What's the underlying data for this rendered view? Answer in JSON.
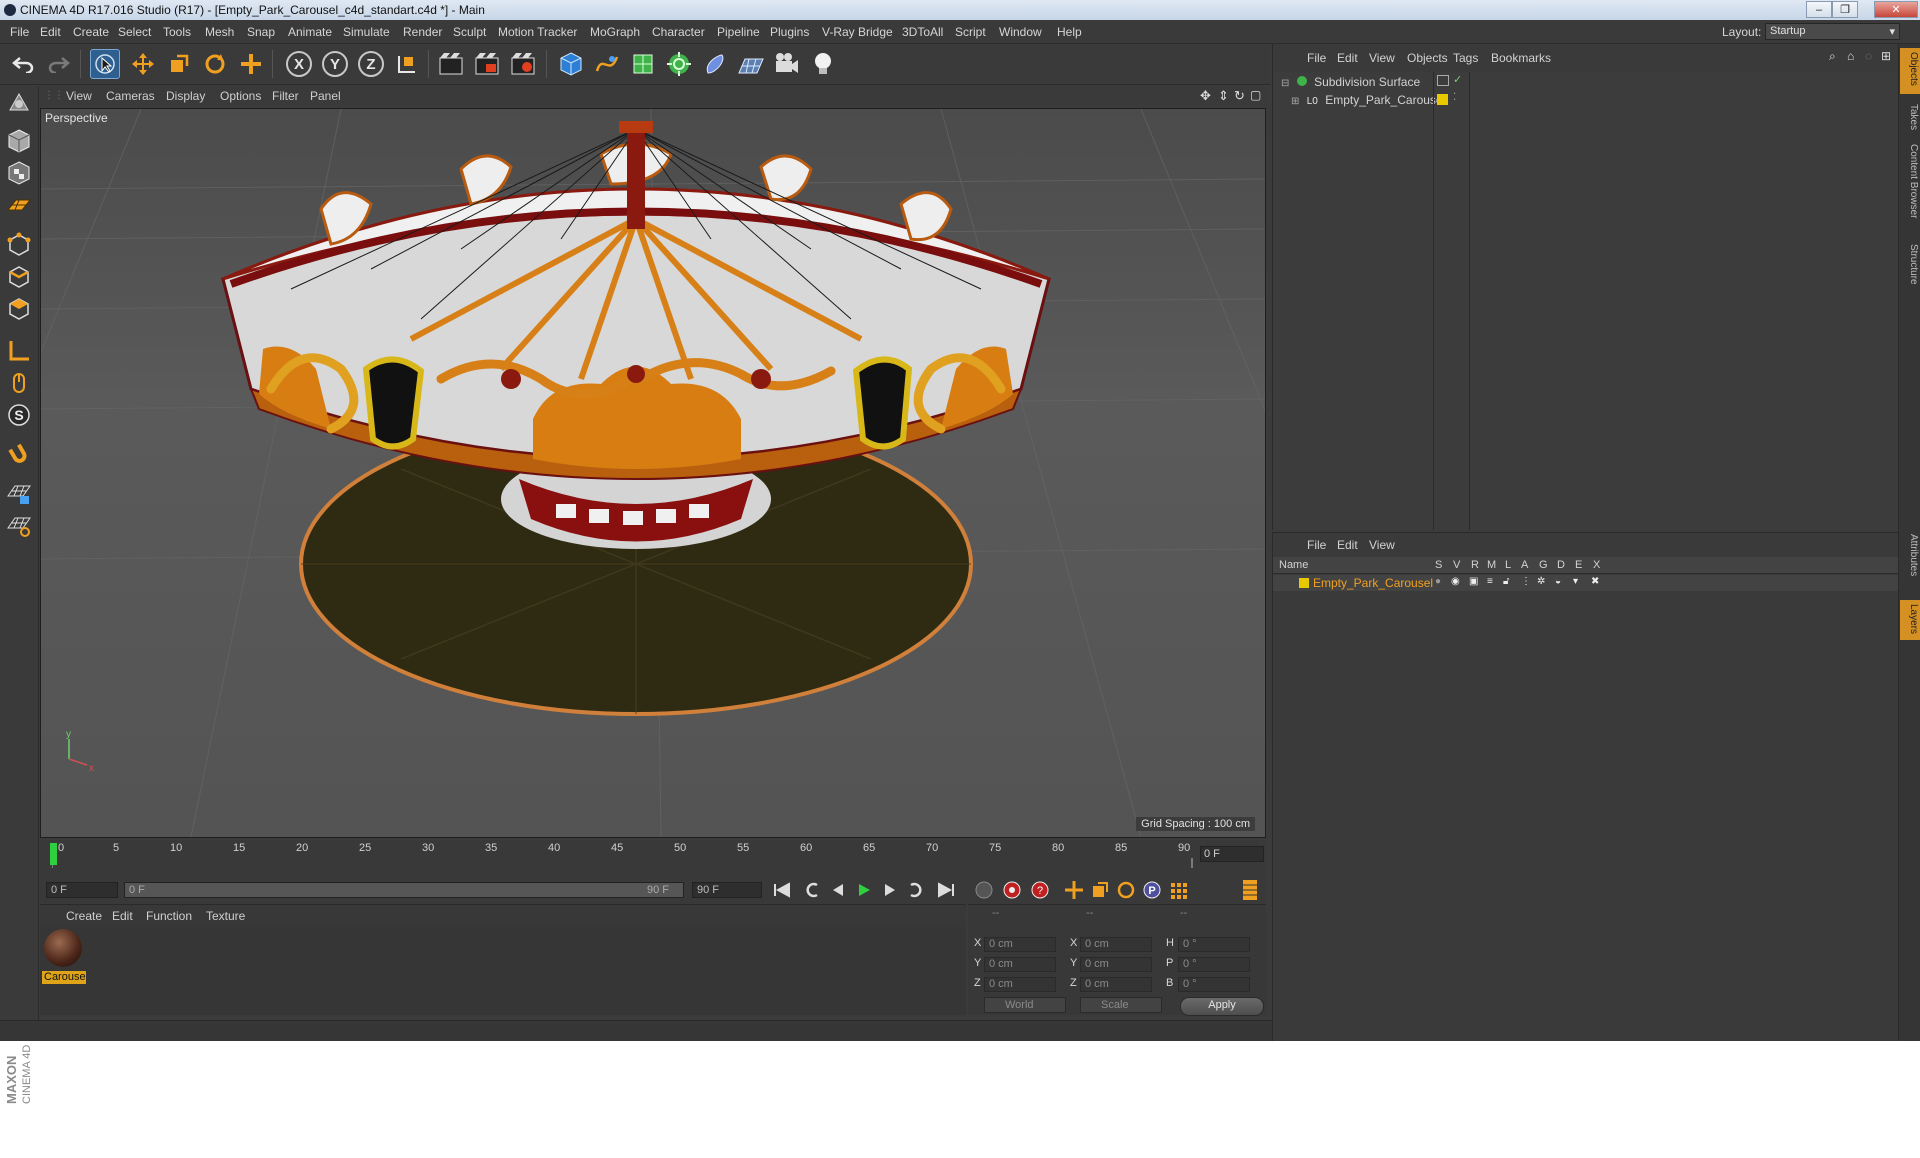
{
  "window": {
    "title": "CINEMA 4D R17.016 Studio (R17) - [Empty_Park_Carousel_c4d_standart.c4d *] - Main",
    "buttons": [
      "–",
      "❐",
      "✕"
    ]
  },
  "menubar": {
    "items": [
      "File",
      "Edit",
      "Create",
      "Select",
      "Tools",
      "Mesh",
      "Snap",
      "Animate",
      "Simulate",
      "Render",
      "Sculpt",
      "Motion Tracker",
      "MoGraph",
      "Character",
      "Pipeline",
      "Plugins",
      "V-Ray Bridge",
      "3DToAll",
      "Script",
      "Window",
      "Help"
    ],
    "layout_label": "Layout:",
    "layout_value": "Startup"
  },
  "toolbar": {
    "axis_x": "X",
    "axis_y": "Y",
    "axis_z": "Z"
  },
  "viewport": {
    "menu": [
      "View",
      "Cameras",
      "Display",
      "Options",
      "Filter",
      "Panel"
    ],
    "camera_label": "Perspective",
    "grid_spacing": "Grid Spacing : 100 cm"
  },
  "timeline": {
    "ticks": [
      "0",
      "5",
      "10",
      "15",
      "20",
      "25",
      "30",
      "35",
      "40",
      "45",
      "50",
      "55",
      "60",
      "65",
      "70",
      "75",
      "80",
      "85",
      "90"
    ],
    "current_frame": "0 F"
  },
  "transport": {
    "start_field": "0 F",
    "range_start": "0 F",
    "range_end": "90 F",
    "end_field": "90 F"
  },
  "material_manager": {
    "menu": [
      "Create",
      "Edit",
      "Function",
      "Texture"
    ],
    "materials": [
      {
        "name": "Carousel"
      }
    ]
  },
  "coordinates": {
    "header": [
      "--",
      "--",
      "--"
    ],
    "rows": [
      {
        "axis": "X",
        "pos": "0 cm",
        "axis2": "X",
        "size": "0 cm",
        "rot_label": "H",
        "rot": "0 °"
      },
      {
        "axis": "Y",
        "pos": "0 cm",
        "axis2": "Y",
        "size": "0 cm",
        "rot_label": "P",
        "rot": "0 °"
      },
      {
        "axis": "Z",
        "pos": "0 cm",
        "axis2": "Z",
        "size": "0 cm",
        "rot_label": "B",
        "rot": "0 °"
      }
    ],
    "mode_world": "World",
    "mode_scale": "Scale",
    "apply": "Apply"
  },
  "object_manager": {
    "menu": [
      "File",
      "Edit",
      "View",
      "Objects",
      "Tags",
      "Bookmarks"
    ],
    "objects": [
      {
        "name": "Subdivision Surface"
      },
      {
        "name": "Empty_Park_Carousel"
      }
    ]
  },
  "layer_manager": {
    "menu": [
      "File",
      "Edit",
      "View"
    ],
    "columns": [
      "Name",
      "S",
      "V",
      "R",
      "M",
      "L",
      "A",
      "G",
      "D",
      "E",
      "X"
    ],
    "layers": [
      {
        "name": "Empty_Park_Carousel"
      }
    ]
  },
  "side_tabs": [
    "Objects",
    "Takes",
    "Content Browser",
    "Structure",
    "Attributes",
    "Layers"
  ],
  "branding": {
    "maxon": "MAXON",
    "cinema": "CINEMA 4D"
  },
  "colors": {
    "accent": "#f0a020",
    "selection_blue": "#2f5f8f",
    "layer_yellow": "#e8c800"
  }
}
